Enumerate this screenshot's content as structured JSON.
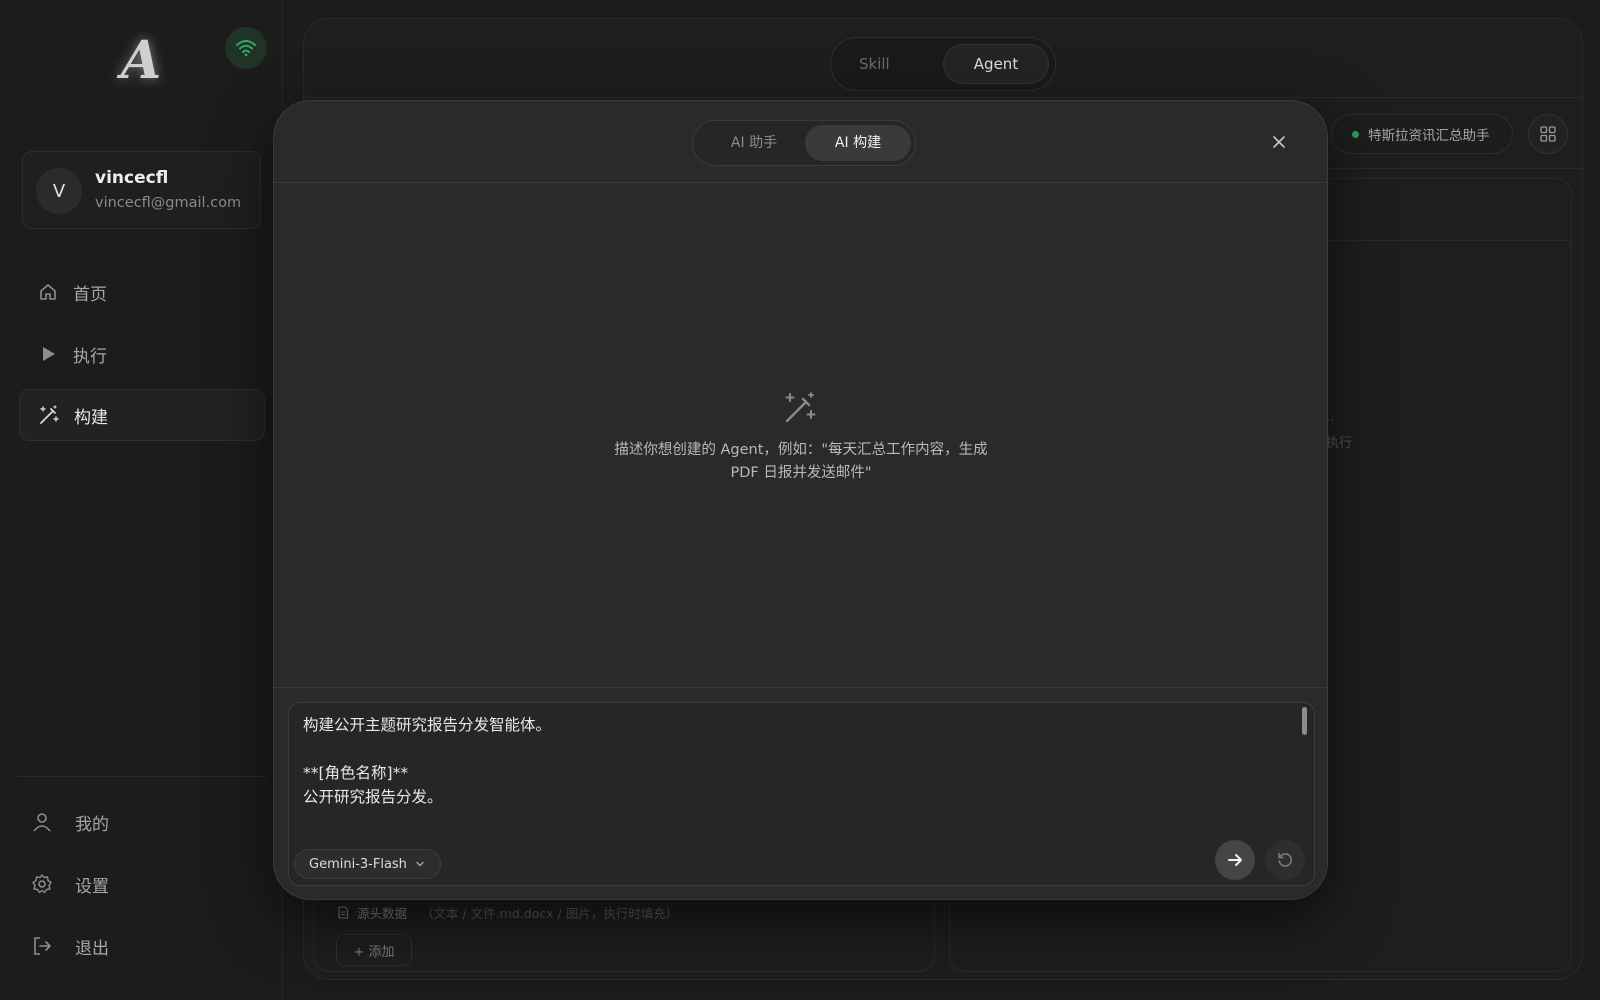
{
  "sidebar": {
    "logo_letter": "A",
    "user": {
      "initial": "V",
      "name": "vincecfl",
      "email": "vincecfl@gmail.com"
    },
    "nav": [
      {
        "label": "首页",
        "icon": "home-icon"
      },
      {
        "label": "执行",
        "icon": "play-icon"
      },
      {
        "label": "构建",
        "icon": "magic-wand-icon"
      }
    ],
    "bottom": [
      {
        "label": "我的",
        "icon": "user-icon"
      },
      {
        "label": "设置",
        "icon": "gear-icon"
      },
      {
        "label": "退出",
        "icon": "logout-icon"
      }
    ]
  },
  "main": {
    "toggle": {
      "skill": "Skill",
      "agent": "Agent"
    },
    "agent_pill": "特斯拉资讯汇总助手",
    "ghost_text_1": "..",
    "ghost_text_2": "执行",
    "source_label": "源头数据",
    "source_hint": "（文本 / 文件.md.docx / 图片，执行时填充）",
    "add_label": "+ 添加"
  },
  "modal": {
    "tabs": {
      "assistant": "AI 助手",
      "build": "AI 构建"
    },
    "empty_line1": "描述你想创建的 Agent，例如：\"每天汇总工作内容，生成",
    "empty_line2": "PDF 日报并发送邮件\"",
    "input_text": "构建公开主题研究报告分发智能体。\n\n**[角色名称]**\n公开研究报告分发。",
    "model": "Gemini-3-Flash"
  },
  "colors": {
    "accent_green": "#2e9b5b",
    "background": "#1c1c1c",
    "modal_bg": "#2a2a2a"
  }
}
